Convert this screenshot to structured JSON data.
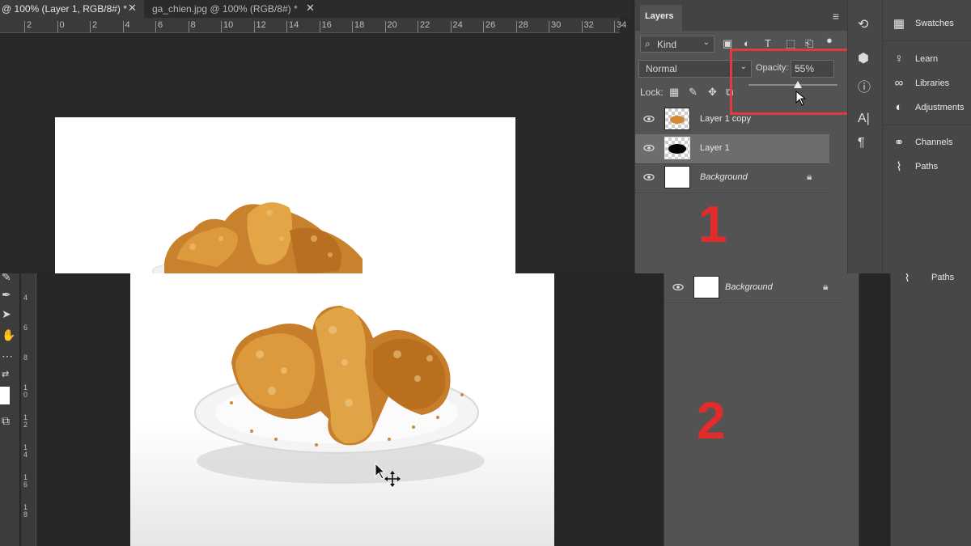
{
  "top": {
    "tabs": [
      {
        "label": "@ 100% (Layer 1, RGB/8#) *",
        "close": "✕",
        "active": true
      },
      {
        "label": "ga_chien.jpg @ 100% (RGB/8#) *",
        "close": "✕",
        "active": false
      }
    ],
    "ruler_ticks": [
      "2",
      "0",
      "2",
      "4",
      "6",
      "8",
      "10",
      "12",
      "14",
      "16",
      "18",
      "20",
      "22",
      "24",
      "26",
      "28",
      "30",
      "32",
      "34"
    ],
    "layers_panel": {
      "title": "Layers",
      "menu_icon": "panel-menu-icon",
      "kind_filter": "Kind",
      "blend_mode": "Normal",
      "opacity_label": "Opacity:",
      "opacity_value": "55%",
      "opacity_fraction": 0.55,
      "lock_label": "Lock:",
      "layers": [
        {
          "name": "Layer 1 copy",
          "thumb": "checker",
          "selected": false,
          "italic": false,
          "locked": false
        },
        {
          "name": "Layer 1",
          "thumb": "mask",
          "selected": true,
          "italic": false,
          "locked": false
        },
        {
          "name": "Background",
          "thumb": "white",
          "selected": false,
          "italic": true,
          "locked": true
        }
      ]
    },
    "annotation_number": "1",
    "right_panel": [
      "Swatches",
      "Learn",
      "Libraries",
      "Adjustments",
      "Channels",
      "Paths"
    ]
  },
  "bottom": {
    "ruler_ticks": [
      "4",
      "6",
      "8",
      "1 0",
      "1 2",
      "1 4",
      "1 6",
      "1 8"
    ],
    "background_layer": "Background",
    "annotation_number": "2",
    "right_panel_item": "Paths"
  },
  "colors": {
    "highlight_red": "#e23b3b",
    "annotation_red": "#e32b2b",
    "panel": "#535353",
    "canvas_bg": "#282828"
  }
}
